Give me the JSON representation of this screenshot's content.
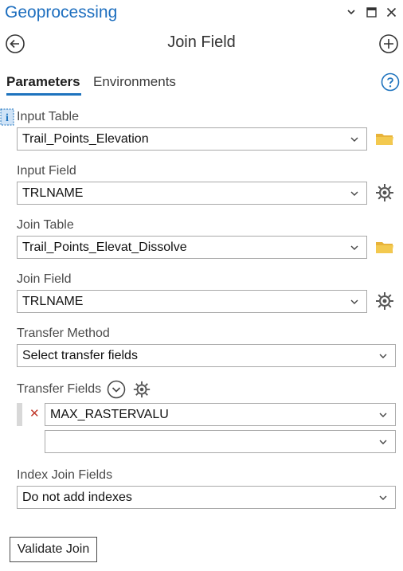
{
  "pane": {
    "title": "Geoprocessing",
    "controls": [
      "chevron-down-icon",
      "maximize-icon",
      "close-icon"
    ]
  },
  "tool": {
    "title": "Join Field",
    "back_icon": "back-arrow-icon",
    "add_icon": "add-icon"
  },
  "tabs": [
    {
      "label": "Parameters",
      "active": true
    },
    {
      "label": "Environments",
      "active": false
    }
  ],
  "help_icon": "help-icon",
  "params": {
    "input_table": {
      "label": "Input Table",
      "value": "Trail_Points_Elevation",
      "icon": "folder-icon"
    },
    "input_field": {
      "label": "Input Field",
      "value": "TRLNAME",
      "icon": "gear-icon"
    },
    "join_table": {
      "label": "Join Table",
      "value": "Trail_Points_Elevat_Dissolve",
      "icon": "folder-icon"
    },
    "join_field": {
      "label": "Join Field",
      "value": "TRLNAME",
      "icon": "gear-icon"
    },
    "transfer_method": {
      "label": "Transfer Method",
      "value": "Select transfer fields"
    },
    "transfer_fields": {
      "label": "Transfer Fields",
      "values": [
        "MAX_RASTERVALU",
        ""
      ]
    },
    "index_join_fields": {
      "label": "Index Join Fields",
      "value": "Do not add indexes"
    }
  },
  "validate_button": "Validate Join",
  "colors": {
    "accent": "#1e73be",
    "title": "#1e6fbf",
    "folder": "#e8b33a",
    "remove": "#c0392b"
  }
}
